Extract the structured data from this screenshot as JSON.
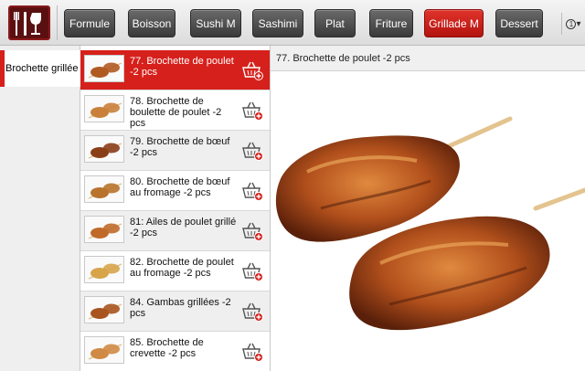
{
  "tabs": [
    {
      "label": "Formule",
      "active": false
    },
    {
      "label": "Boisson",
      "active": false
    },
    {
      "label": "Sushi M",
      "active": false
    },
    {
      "label": "Sashimi",
      "active": false
    },
    {
      "label": "Plat",
      "active": false
    },
    {
      "label": "Friture",
      "active": false
    },
    {
      "label": "Grillade M",
      "active": true
    },
    {
      "label": "Dessert",
      "active": false
    }
  ],
  "more_icon": "info-circle-chevron-icon",
  "category": {
    "label": "Brochette grillée"
  },
  "items": [
    {
      "label": "77. Brochette de poulet -2 pcs",
      "selected": true
    },
    {
      "label": "78. Brochette de boulette de poulet -2 pcs",
      "selected": false
    },
    {
      "label": "79. Brochette de bœuf -2 pcs",
      "selected": false
    },
    {
      "label": "80. Brochette de bœuf au fromage -2 pcs",
      "selected": false
    },
    {
      "label": "81: Ailes de poulet grillé -2 pcs",
      "selected": false
    },
    {
      "label": "82. Brochette de poulet au fromage -2 pcs",
      "selected": false
    },
    {
      "label": "84. Gambas grillées -2 pcs",
      "selected": false
    },
    {
      "label": "85. Brochette de crevette -2 pcs",
      "selected": false
    }
  ],
  "detail": {
    "title": "77. Brochette de poulet -2 pcs"
  },
  "colors": {
    "accent": "#d6201b",
    "tab_dark": "#3a3a3a"
  }
}
